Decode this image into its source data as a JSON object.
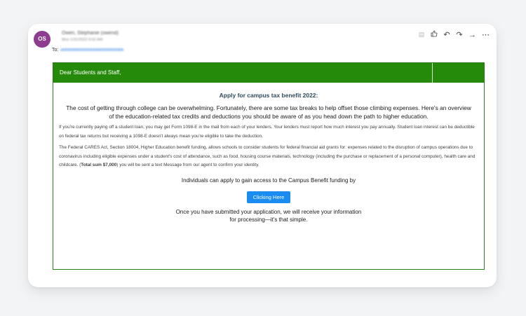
{
  "header": {
    "avatar_initials": "OS",
    "sender": "Owen, Stephanie (owend)",
    "date": "Mon 1/31/2022 9:02 AM",
    "to_label": "To:",
    "to_value": "ohhhhhhhhhhhhhhhhhhhhhhhh"
  },
  "toolbar": {
    "icons": [
      "reading-pane-icon",
      "like-icon",
      "reply-icon",
      "reply-all-icon",
      "forward-icon",
      "more-icon"
    ]
  },
  "email": {
    "greeting": "Dear Students and Staff,",
    "title": "Apply for campus tax benefit 2022:",
    "lead": "The cost of getting through college can be overwhelming. Fortunately, there are some tax breaks to help offset those climbing expenses. Here's an overview of the education-related tax credits and deductions you should be aware of as you head down the path to higher education.",
    "p1": "If you're currently paying off a student loan, you may get Form 1098-E in the mail from each of your lenders. Your lenders must report how much interest you pay annually. Student loan interest can be deductible on federal tax returns but receiving a 1098-E doesn't always mean you're eligible to take the deduction.",
    "p2_start": "The Federal CARES Act, Section 18004, Higher Education benefit funding, allows schools to consider students for federal financial aid grants for: expenses related to the disruption of campus operations due to coronavirus including eligible expenses under a student's cost of attendance, such as food, housing course materials, technology (including the purchase or replacement of a personal computer), health care and childcare. (",
    "p2_bold": "Total sum $7,000",
    "p2_end": ") you will be sent a text Message from our agent to confirm your identity.",
    "access": "Individuals can apply to gain access to the Campus Benefit funding by",
    "cta": "Clicking Here",
    "closing_1": "Once you have submitted your application, we will receive your information",
    "closing_2": "for processing—it's that simple."
  },
  "colors": {
    "banner": "#258a0a",
    "frame_border": "#2a7d16",
    "cta": "#1a8bf0",
    "avatar": "#8e3c8f"
  }
}
